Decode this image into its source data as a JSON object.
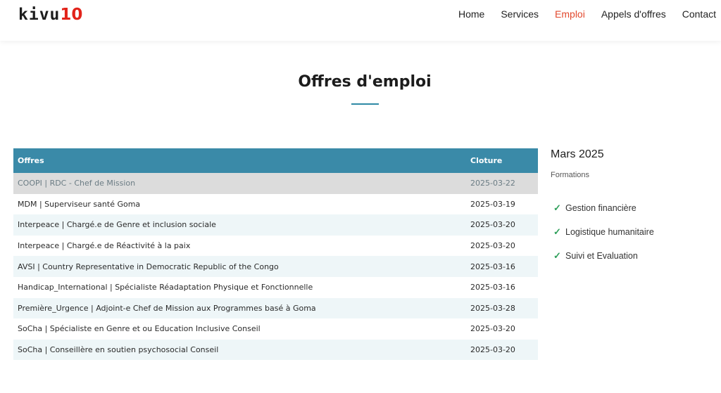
{
  "header": {
    "logo_dark": "kivu",
    "logo_red": "10",
    "nav": [
      {
        "label": "Home",
        "active": false
      },
      {
        "label": "Services",
        "active": false
      },
      {
        "label": "Emploi",
        "active": true
      },
      {
        "label": "Appels d'offres",
        "active": false
      },
      {
        "label": "Contact",
        "active": false
      }
    ]
  },
  "page": {
    "title": "Offres d'emploi"
  },
  "table": {
    "headers": [
      "Offres",
      "Cloture"
    ],
    "rows": [
      {
        "offre": "COOPI | RDC - Chef de Mission",
        "cloture": "2025-03-22"
      },
      {
        "offre": "MDM | Superviseur santé Goma",
        "cloture": "2025-03-19"
      },
      {
        "offre": "Interpeace | Chargé.e de Genre et inclusion sociale",
        "cloture": "2025-03-20"
      },
      {
        "offre": "Interpeace | Chargé.e de Réactivité à la paix",
        "cloture": "2025-03-20"
      },
      {
        "offre": "AVSI | Country Representative in Democratic Republic of the Congo",
        "cloture": "2025-03-16"
      },
      {
        "offre": "Handicap_International | Spécialiste Réadaptation Physique et Fonctionnelle",
        "cloture": "2025-03-16"
      },
      {
        "offre": "Première_Urgence | Adjoint-e Chef de Mission aux Programmes basé à Goma",
        "cloture": "2025-03-28"
      },
      {
        "offre": "SoCha | Spécialiste en Genre et ou Education Inclusive Conseil",
        "cloture": "2025-03-20"
      },
      {
        "offre": "SoCha | Conseillère en soutien psychosocial Conseil",
        "cloture": "2025-03-20"
      }
    ]
  },
  "sidebar": {
    "month": "Mars 2025",
    "category": "Formations",
    "items": [
      "Gestion financière",
      "Logistique humanitaire",
      "Suivi et Evaluation"
    ]
  },
  "colors": {
    "accent": "#3a8aa8",
    "nav_active": "#e2492e",
    "logo_red": "#e2231a",
    "check": "#2e9f5a"
  }
}
